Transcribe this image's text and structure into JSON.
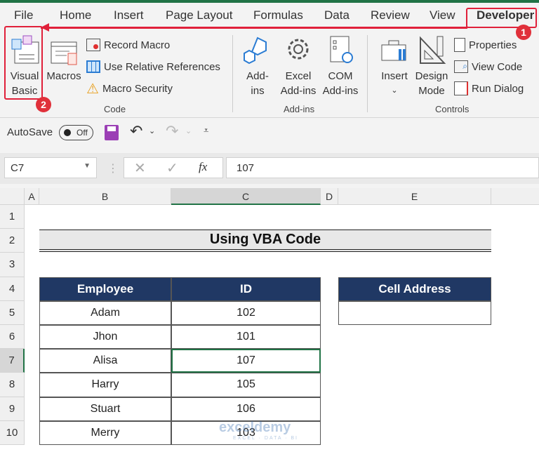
{
  "tabs": [
    "File",
    "Home",
    "Insert",
    "Page Layout",
    "Formulas",
    "Data",
    "Review",
    "View",
    "Developer"
  ],
  "active_tab": "Developer",
  "ribbon": {
    "code": {
      "visual_basic": [
        "Visual",
        "Basic"
      ],
      "macros": "Macros",
      "record_macro": "Record Macro",
      "use_relative": "Use Relative References",
      "macro_security": "Macro Security",
      "group": "Code"
    },
    "addins": {
      "addins": [
        "Add-",
        "ins"
      ],
      "excel_addins": [
        "Excel",
        "Add-ins"
      ],
      "com_addins": [
        "COM",
        "Add-ins"
      ],
      "group": "Add-ins"
    },
    "controls": {
      "insert": "Insert",
      "design_mode": [
        "Design",
        "Mode"
      ],
      "properties": "Properties",
      "view_code": "View Code",
      "run_dialog": "Run Dialog",
      "group": "Controls"
    }
  },
  "qat": {
    "autosave": "AutoSave",
    "toggle": "Off"
  },
  "formula_bar": {
    "name_box": "C7",
    "fx": "fx",
    "value": "107"
  },
  "columns": [
    "A",
    "B",
    "C",
    "D",
    "E"
  ],
  "rows": [
    "1",
    "2",
    "3",
    "4",
    "5",
    "6",
    "7",
    "8",
    "9",
    "10"
  ],
  "title": "Using VBA Code",
  "table": {
    "headers": [
      "Employee",
      "ID"
    ],
    "rows": [
      [
        "Adam",
        "102"
      ],
      [
        "Jhon",
        "101"
      ],
      [
        "Alisa",
        "107"
      ],
      [
        "Harry",
        "105"
      ],
      [
        "Stuart",
        "106"
      ],
      [
        "Merry",
        "103"
      ]
    ]
  },
  "cell_address": {
    "header": "Cell Address",
    "value": ""
  },
  "annotations": {
    "step1": "1",
    "step2": "2"
  },
  "watermark": {
    "name": "exceldemy",
    "tagline": "EXCEL · DATA · BI"
  },
  "colors": {
    "header_bg": "#203864",
    "annotation": "#e0203a",
    "excel_green": "#217346"
  }
}
